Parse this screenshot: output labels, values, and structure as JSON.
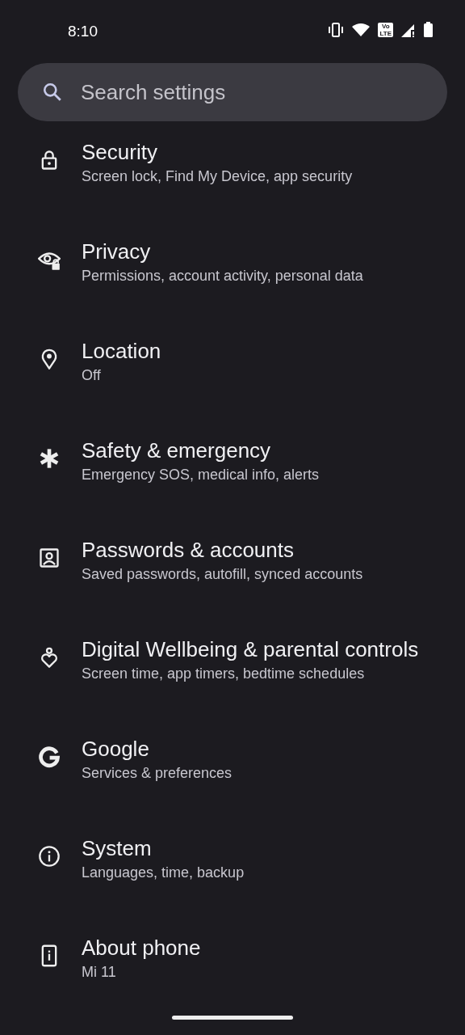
{
  "status_bar": {
    "time": "8:10",
    "volte": [
      "Vo",
      "LTE"
    ]
  },
  "search": {
    "placeholder": "Search settings"
  },
  "items": [
    {
      "title": "Security",
      "subtitle": "Screen lock, Find My Device, app security"
    },
    {
      "title": "Privacy",
      "subtitle": "Permissions, account activity, personal data"
    },
    {
      "title": "Location",
      "subtitle": "Off"
    },
    {
      "title": "Safety & emergency",
      "subtitle": "Emergency SOS, medical info, alerts"
    },
    {
      "title": "Passwords & accounts",
      "subtitle": "Saved passwords, autofill, synced accounts"
    },
    {
      "title": "Digital Wellbeing & parental controls",
      "subtitle": "Screen time, app timers, bedtime schedules"
    },
    {
      "title": "Google",
      "subtitle": "Services & preferences"
    },
    {
      "title": "System",
      "subtitle": "Languages, time, backup"
    },
    {
      "title": "About phone",
      "subtitle": "Mi 11"
    }
  ]
}
